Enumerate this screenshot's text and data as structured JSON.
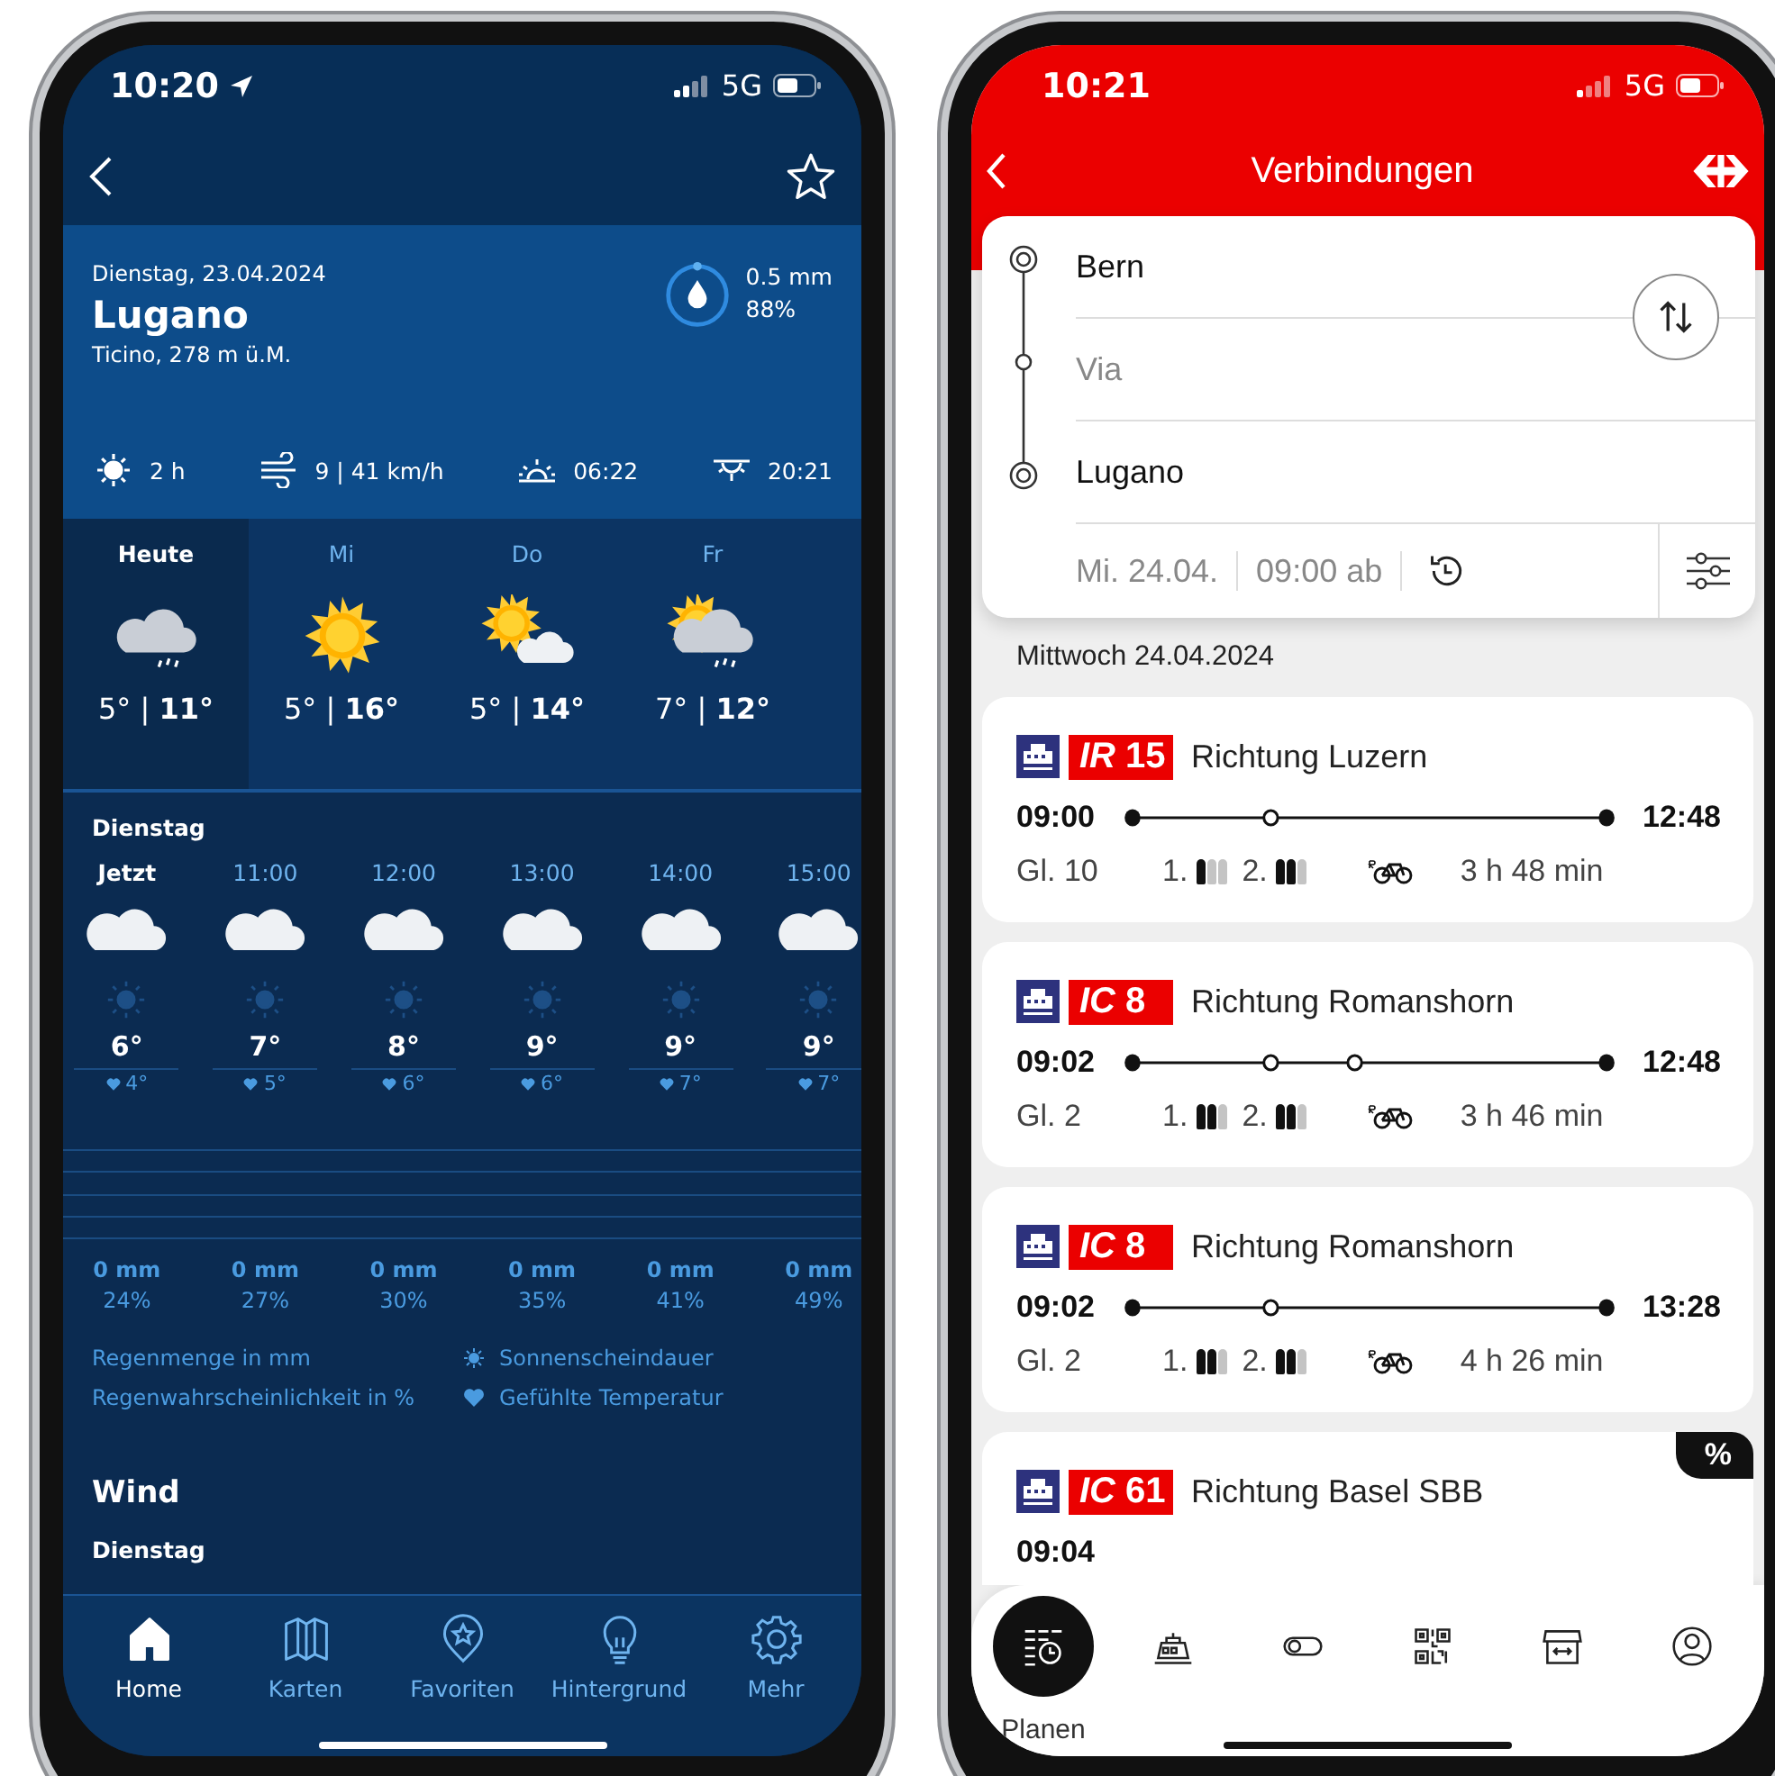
{
  "weather_app": {
    "status_bar": {
      "time": "10:20",
      "network": "5G"
    },
    "header": {
      "date": "Dienstag, 23.04.2024",
      "city": "Lugano",
      "region": "Ticino, 278 m ü.M.",
      "precip_amount": "0.5 mm",
      "precip_probability": "88%"
    },
    "stats": [
      {
        "kind": "sun",
        "value": "2 h"
      },
      {
        "kind": "wind",
        "value": "9 | 41 km/h"
      },
      {
        "kind": "sunrise",
        "value": "06:22"
      },
      {
        "kind": "sunset",
        "value": "20:21"
      }
    ],
    "days": [
      {
        "label": "Heute",
        "kind": "cloud-rain",
        "temps": "5° | **11°**",
        "selected": true
      },
      {
        "label": "Mi",
        "kind": "sun",
        "temps": "5° | **16°**",
        "selected": false
      },
      {
        "label": "Do",
        "kind": "sun-cloud",
        "temps": "5° | **14°**",
        "selected": false
      },
      {
        "label": "Fr",
        "kind": "sun-cloud-rain",
        "temps": "7° | **12°**",
        "selected": false
      }
    ],
    "hourly_title": "Dienstag",
    "hours": [
      {
        "time": "Jetzt",
        "kind": "cloud",
        "temp": "6°",
        "feels": "4°",
        "amount": "0 mm",
        "probability": "24%",
        "selected": true
      },
      {
        "time": "11:00",
        "kind": "cloud",
        "temp": "7°",
        "feels": "5°",
        "amount": "0 mm",
        "probability": "27%",
        "selected": false
      },
      {
        "time": "12:00",
        "kind": "cloud",
        "temp": "8°",
        "feels": "6°",
        "amount": "0 mm",
        "probability": "30%",
        "selected": false
      },
      {
        "time": "13:00",
        "kind": "cloud",
        "temp": "9°",
        "feels": "6°",
        "amount": "0 mm",
        "probability": "35%",
        "selected": false
      },
      {
        "time": "14:00",
        "kind": "cloud",
        "temp": "9°",
        "feels": "7°",
        "amount": "0 mm",
        "probability": "41%",
        "selected": false
      },
      {
        "time": "15:00",
        "kind": "cloud",
        "temp": "9°",
        "feels": "7°",
        "amount": "0 mm",
        "probability": "49%",
        "selected": false
      }
    ],
    "legend": [
      {
        "kind": "plain",
        "text": "Regenmenge in mm"
      },
      {
        "kind": "sun",
        "text": "Sonnenscheindauer"
      },
      {
        "kind": "plain",
        "text": "Regenwahrscheinlichkeit in %"
      },
      {
        "kind": "heart",
        "text": "Gefühlte Temperatur"
      }
    ],
    "wind_title": "Wind",
    "wind_day": "Dienstag",
    "tabs": [
      {
        "label": "Home",
        "kind": "home",
        "selected": true
      },
      {
        "label": "Karten",
        "kind": "map",
        "selected": false
      },
      {
        "label": "Favoriten",
        "kind": "favorites",
        "selected": false
      },
      {
        "label": "Hintergrund",
        "kind": "bulb",
        "selected": false
      },
      {
        "label": "Mehr",
        "kind": "gear",
        "selected": false
      }
    ]
  },
  "sbb_app": {
    "status_bar": {
      "time": "10:21",
      "network": "5G"
    },
    "title": "Verbindungen",
    "route": {
      "from": "Bern",
      "via_placeholder": "Via",
      "to": "Lugano",
      "date": "Mi. 24.04.",
      "time": "09:00 ab"
    },
    "date_header": "Mittwoch 24.04.2024",
    "connections": [
      {
        "product": "IR",
        "number": "15",
        "direction": "Richtung Luzern",
        "departure": "09:00",
        "arrival": "12:48",
        "platform": "Gl. 10",
        "first_class": {
          "label": "1.",
          "figures": [
            {
              "filled": true
            },
            {
              "filled": false
            },
            {
              "filled": false
            }
          ]
        },
        "second_class": {
          "label": "2.",
          "figures": [
            {
              "filled": true
            },
            {
              "filled": true
            },
            {
              "filled": false
            }
          ]
        },
        "duration": "3 h 48 min",
        "stops": [
          {
            "kind": "change"
          }
        ]
      },
      {
        "product": "IC",
        "number": "8",
        "direction": "Richtung Romanshorn",
        "departure": "09:02",
        "arrival": "12:48",
        "platform": "Gl. 2",
        "first_class": {
          "label": "1.",
          "figures": [
            {
              "filled": true
            },
            {
              "filled": true
            },
            {
              "filled": false
            }
          ]
        },
        "second_class": {
          "label": "2.",
          "figures": [
            {
              "filled": true
            },
            {
              "filled": true
            },
            {
              "filled": false
            }
          ]
        },
        "duration": "3 h 46 min",
        "stops": [
          {
            "kind": "change"
          },
          {
            "kind": "change"
          }
        ]
      },
      {
        "product": "IC",
        "number": "8",
        "direction": "Richtung Romanshorn",
        "departure": "09:02",
        "arrival": "13:28",
        "platform": "Gl. 2",
        "first_class": {
          "label": "1.",
          "figures": [
            {
              "filled": true
            },
            {
              "filled": true
            },
            {
              "filled": false
            }
          ]
        },
        "second_class": {
          "label": "2.",
          "figures": [
            {
              "filled": true
            },
            {
              "filled": true
            },
            {
              "filled": false
            }
          ]
        },
        "duration": "4 h 26 min",
        "stops": [
          {
            "kind": "change"
          }
        ]
      },
      {
        "product": "IC",
        "number": "61",
        "direction": "Richtung Basel SBB",
        "departure": "09:04",
        "discount": "%"
      }
    ],
    "tabs": [
      {
        "kind": "planner",
        "label": "Planen",
        "selected": true
      },
      {
        "kind": "train",
        "selected": false
      },
      {
        "kind": "toggle",
        "selected": false
      },
      {
        "kind": "qr",
        "selected": false
      },
      {
        "kind": "shop",
        "selected": false
      },
      {
        "kind": "profile",
        "selected": false
      }
    ]
  }
}
